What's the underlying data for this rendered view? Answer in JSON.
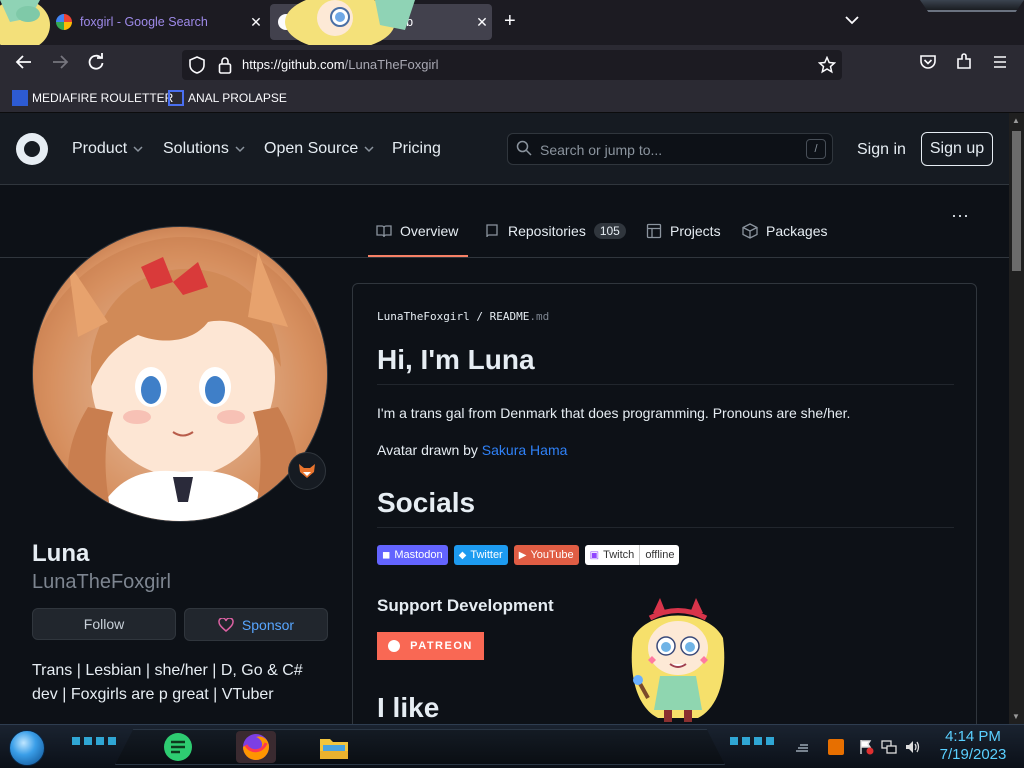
{
  "browser": {
    "tabs": [
      {
        "title": "foxgirl - Google Search",
        "close": "✕"
      },
      {
        "title": "a) · GitHub",
        "close": "✕"
      }
    ],
    "new_tab": "+",
    "tabs_menu": "⌄",
    "url_host": "https://github.com",
    "url_path": "/LunaTheFoxgirl",
    "bookmarks": [
      {
        "label": "MEDIAFIRE ROULETTER"
      },
      {
        "label": "ANAL PROLAPSE"
      }
    ]
  },
  "github_header": {
    "menu": [
      {
        "label": "Product",
        "has_chevron": true
      },
      {
        "label": "Solutions",
        "has_chevron": true
      },
      {
        "label": "Open Source",
        "has_chevron": true
      },
      {
        "label": "Pricing",
        "has_chevron": false
      }
    ],
    "search_placeholder": "Search or jump to...",
    "search_shortcut": "/",
    "sign_in": "Sign in",
    "sign_up": "Sign up"
  },
  "profile_nav": {
    "tabs": [
      {
        "label": "Overview",
        "icon": "book-icon"
      },
      {
        "label": "Repositories",
        "icon": "repo-icon",
        "count": "105"
      },
      {
        "label": "Projects",
        "icon": "table-icon"
      },
      {
        "label": "Packages",
        "icon": "package-icon"
      }
    ],
    "more": "···"
  },
  "profile": {
    "display_name": "Luna",
    "username": "LunaTheFoxgirl",
    "follow": "Follow",
    "sponsor": "Sponsor",
    "bio": "Trans | Lesbian | she/her | D, Go & C# dev | Foxgirls are p great | VTuber"
  },
  "readme": {
    "crumb_user": "LunaTheFoxgirl",
    "crumb_sep": "/",
    "crumb_file": "README",
    "crumb_ext": ".md",
    "h1": "Hi, I'm Luna",
    "intro": "I'm a trans gal from Denmark that does programming. Pronouns are she/her.",
    "avatar_prefix": "Avatar drawn by ",
    "avatar_link": "Sakura Hama",
    "socials_heading": "Socials",
    "badges": [
      {
        "label": "Mastodon",
        "color": "#6364ff"
      },
      {
        "label": "Twitter",
        "color": "#1d9bf0"
      },
      {
        "label": "YouTube",
        "color": "#e05d44"
      },
      {
        "label": "Twitch",
        "status": "offline",
        "color": "#ffffff"
      }
    ],
    "support_heading": "Support Development",
    "patreon": "PATREON",
    "ilike_heading": "I like"
  },
  "taskbar": {
    "time": "4:14 PM",
    "date": "7/19/2023"
  },
  "colors": {
    "accent_underline": "#f78166",
    "link": "#2f81f7",
    "patreon": "#f96854"
  }
}
